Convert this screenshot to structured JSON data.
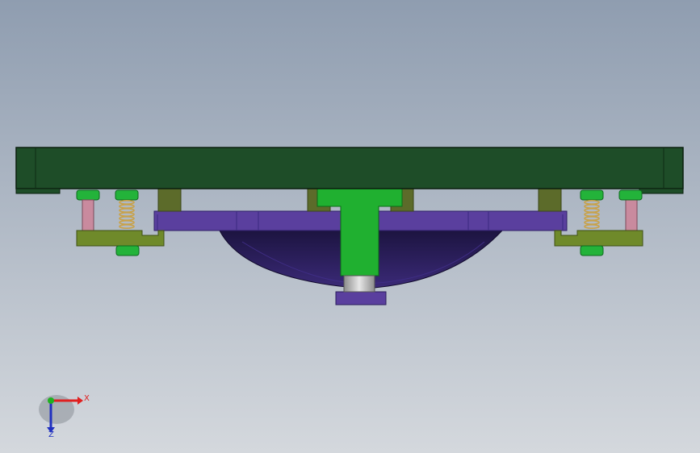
{
  "viewport": {
    "background_top": "#8f9db0",
    "background_bottom": "#d4d8dd"
  },
  "model": {
    "colors": {
      "base_plate": "#1e4d28",
      "base_plate_edge": "#0f2a14",
      "post": "#5c6b2a",
      "bracket": "#6f8a2a",
      "nut": "#23b33a",
      "pin": "#c98a9e",
      "spring": "#c8a24a",
      "ring_plate": "#5a3f9e",
      "dome": "#2a1d52",
      "punch": "#20b030",
      "bushing": "#bfbfbf",
      "bottom_cap": "#5a3f9e"
    }
  },
  "triad": {
    "x_label": "X",
    "z_label": "Z",
    "x_color": "#e02020",
    "y_color": "#20b020",
    "z_color": "#2030c0"
  }
}
